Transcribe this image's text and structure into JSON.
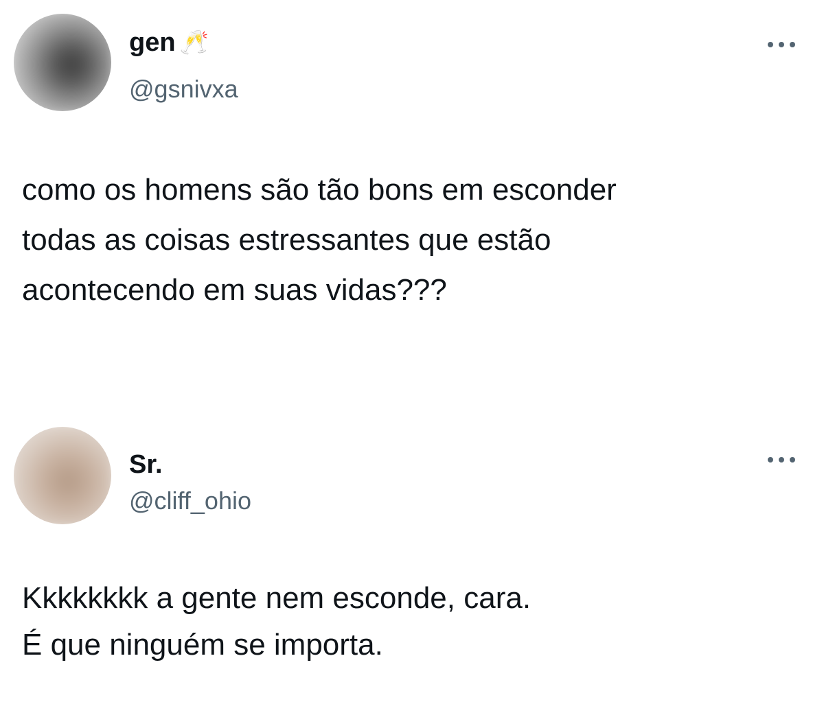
{
  "tweets": [
    {
      "display_name": "gen",
      "name_emoji": "🥂",
      "handle": "@gsnivxa",
      "more_icon": "more-horizontal-icon",
      "text": "como os homens são tão bons em esconder\ntodas as coisas estressantes que estão\nacontecendo em suas vidas???"
    },
    {
      "display_name": "Sr.",
      "handle": "@cliff_ohio",
      "more_icon": "more-horizontal-icon",
      "text": "Kkkkkkkk a gente nem esconde, cara.\nÉ que ninguém se importa."
    }
  ],
  "colors": {
    "text_primary": "#0f1419",
    "text_secondary": "#536471",
    "background": "#ffffff"
  }
}
